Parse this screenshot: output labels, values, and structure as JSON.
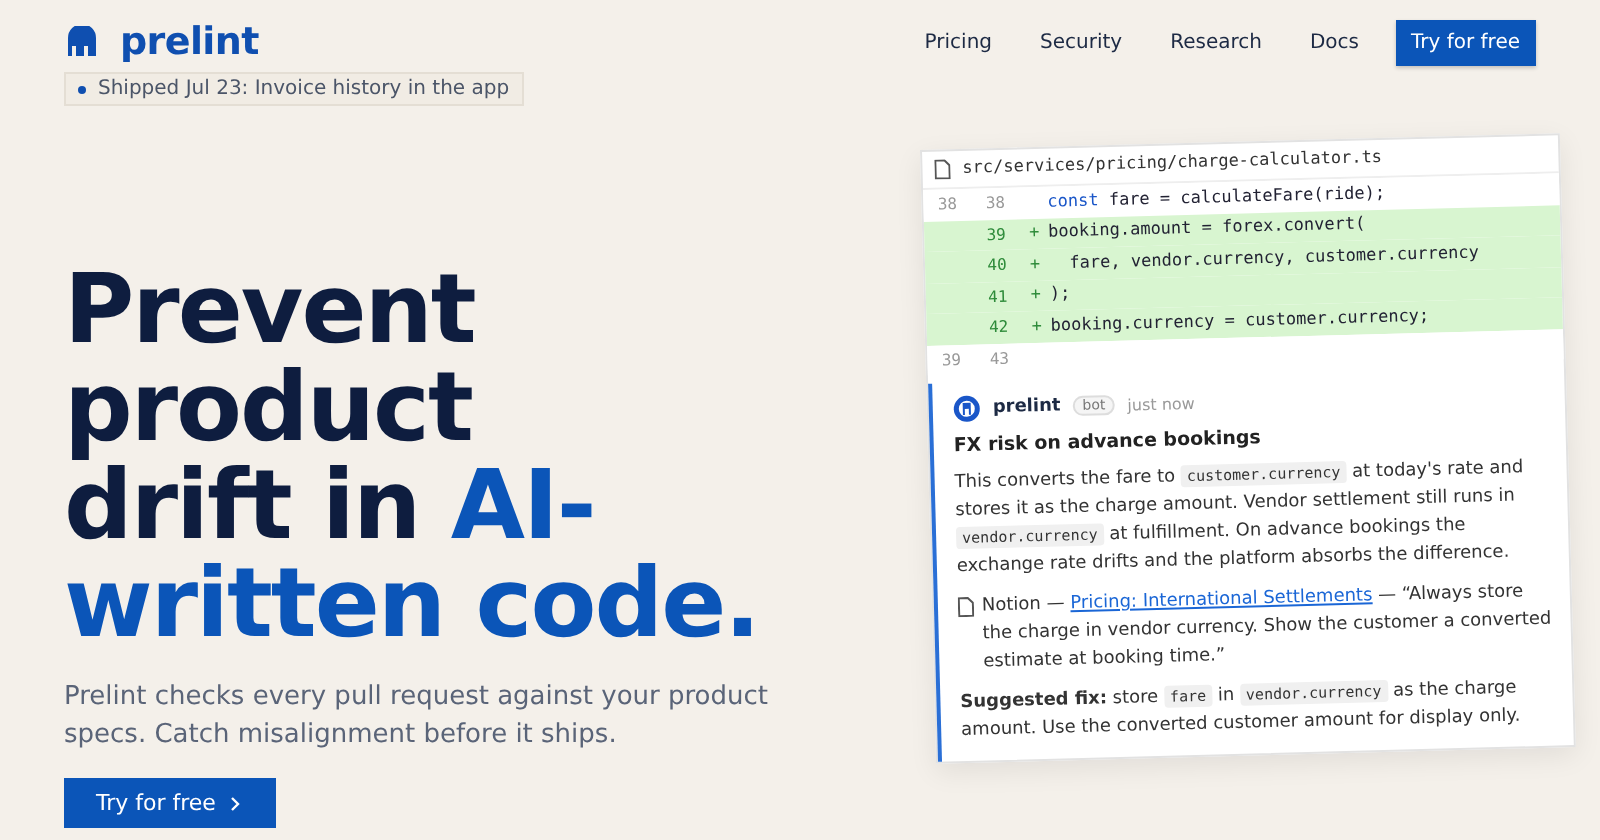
{
  "brand": {
    "name": "prelint"
  },
  "nav": {
    "links": [
      "Pricing",
      "Security",
      "Research",
      "Docs"
    ],
    "cta": "Try for free"
  },
  "announcement": "Shipped Jul 23: Invoice history in the app",
  "hero": {
    "headline": [
      [
        {
          "text": "Prevent",
          "accent": false
        }
      ],
      [
        {
          "text": "product",
          "accent": false
        }
      ],
      [
        {
          "text": "drift in ",
          "accent": false
        },
        {
          "text": "AI-",
          "accent": true
        }
      ],
      [
        {
          "text": "written code.",
          "accent": true
        }
      ]
    ],
    "subtitle": "Prelint checks every pull request against your product specs. Catch misalignment before it ships.",
    "cta": "Try for free"
  },
  "review": {
    "file": "src/services/pricing/charge-calculator.ts",
    "diff": [
      {
        "kind": "context",
        "old": "38",
        "new": "38",
        "keyword": "const",
        "code": " fare = calculateFare(ride);"
      },
      {
        "kind": "added",
        "new": "39",
        "sign": "+",
        "code": "booking.amount = forex.convert("
      },
      {
        "kind": "added",
        "new": "40",
        "sign": "+",
        "code": "  fare, vendor.currency, customer.currency"
      },
      {
        "kind": "added",
        "new": "41",
        "sign": "+",
        "code": ");"
      },
      {
        "kind": "added",
        "new": "42",
        "sign": "+",
        "code": "booking.currency = customer.currency;"
      },
      {
        "kind": "context",
        "old": "39",
        "new": "43"
      }
    ],
    "comment": {
      "author": "prelint",
      "badge": "bot",
      "time": "just now",
      "title": "FX risk on advance bookings",
      "body": [
        {
          "kind": "text",
          "text": "This converts the fare to "
        },
        {
          "kind": "code",
          "text": "customer.currency"
        },
        {
          "kind": "text",
          "text": " at today's rate and stores it as the charge amount. Vendor settlement still runs in "
        },
        {
          "kind": "code",
          "text": "vendor.currency"
        },
        {
          "kind": "text",
          "text": " at fulfillment. On advance bookings the exchange rate drifts and the platform absorbs the difference."
        }
      ],
      "source": {
        "app": "Notion — ",
        "link": "Pricing: International Settlements",
        "quote": " — “Always store the charge in vendor currency. Show the customer a converted estimate at booking time.”"
      },
      "fix": [
        {
          "kind": "bold",
          "text": "Suggested fix:"
        },
        {
          "kind": "text",
          "text": " store "
        },
        {
          "kind": "code",
          "text": "fare"
        },
        {
          "kind": "text",
          "text": " in "
        },
        {
          "kind": "code",
          "text": "vendor.currency"
        },
        {
          "kind": "text",
          "text": " as the charge amount. Use the converted customer amount for display only."
        }
      ]
    }
  }
}
